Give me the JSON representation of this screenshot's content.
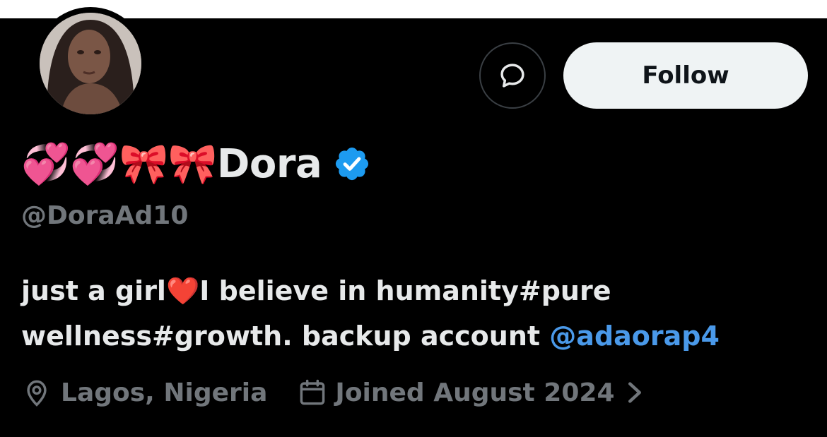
{
  "profile": {
    "display_name": "💞💞🎀🎀Dora",
    "handle": "@DoraAd10",
    "verified": true,
    "bio_line1": "just a girl❤️I believe in humanity#pure",
    "bio_line2_text": "wellness#growth. backup account ",
    "bio_mention": "@adaorap4",
    "location": "Lagos, Nigeria",
    "joined": "Joined August 2024",
    "follow_label": "Follow"
  },
  "icons": {
    "dm": "message-icon",
    "verified": "verified-badge-icon",
    "location": "location-pin-icon",
    "calendar": "calendar-icon",
    "chevron": "chevron-right-icon"
  },
  "colors": {
    "background": "#000000",
    "text_primary": "#e7e9ea",
    "text_secondary": "#71767b",
    "link": "#4a99e9",
    "verified": "#1d9bf0",
    "follow_bg": "#eff3f4"
  }
}
